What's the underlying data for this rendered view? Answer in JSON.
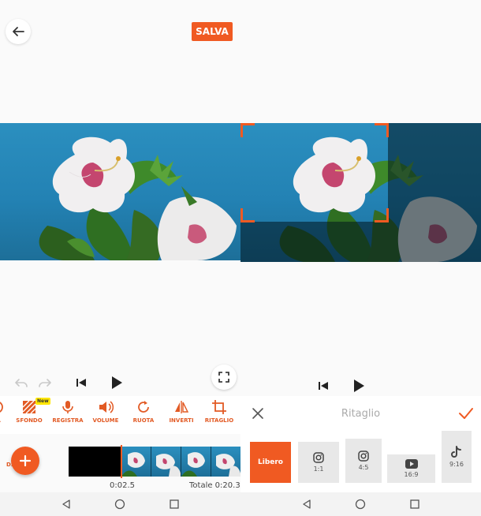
{
  "editor": {
    "save_label": "SALVA",
    "tools": [
      {
        "label": "TÀ",
        "icon": "partial-icon"
      },
      {
        "label": "SFONDO",
        "icon": "background-icon",
        "badge": "New"
      },
      {
        "label": "REGISTRA",
        "icon": "microphone-icon"
      },
      {
        "label": "VOLUME",
        "icon": "volume-icon"
      },
      {
        "label": "RUOTA",
        "icon": "rotate-icon"
      },
      {
        "label": "INVERTI",
        "icon": "flip-icon"
      },
      {
        "label": "RITAGLIO",
        "icon": "crop-icon"
      }
    ],
    "add_audio_label": "D...dio",
    "current_time": "0:02.5",
    "total_time": "Totale 0:20.3"
  },
  "crop": {
    "title": "Ritaglio",
    "ratios": [
      {
        "label": "Libero",
        "active": true
      },
      {
        "label": "1:1",
        "icon": "instagram-icon"
      },
      {
        "label": "4:5",
        "icon": "instagram-icon"
      },
      {
        "label": "16:9",
        "icon": "youtube-icon"
      },
      {
        "label": "9:16",
        "icon": "tiktok-icon"
      }
    ]
  },
  "colors": {
    "accent": "#f05a22"
  }
}
